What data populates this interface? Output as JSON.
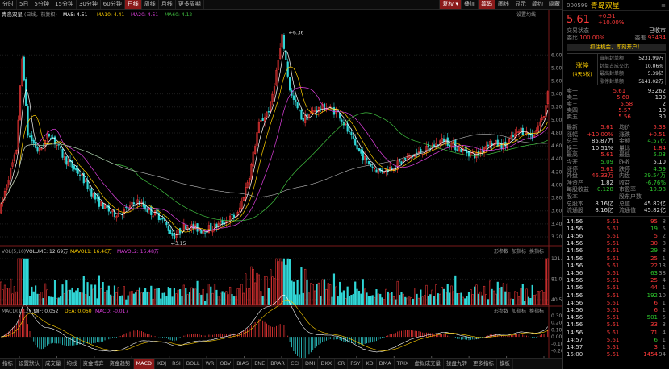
{
  "timeframes": [
    "分时",
    "5日",
    "5分钟",
    "15分钟",
    "30分钟",
    "60分钟",
    "日线",
    "周线",
    "月线",
    "更多周期"
  ],
  "active_timeframe": 6,
  "tools": [
    "叠加",
    "筹码",
    "画线",
    "显示",
    "简约",
    "隐藏"
  ],
  "restore_label": "复权",
  "chart_header": {
    "title": "青岛双星",
    "adj": "(日线，前复权)",
    "ma": [
      {
        "label": "MA5: 4.51",
        "color": "#ffffff"
      },
      {
        "label": "MA10: 4.41",
        "color": "#ffd000"
      },
      {
        "label": "MA20: 4.51",
        "color": "#e040e0"
      },
      {
        "label": "MA60: 4.12",
        "color": "#40c040"
      }
    ],
    "setting": "设置均线"
  },
  "price_axis": [
    "6.00",
    "5.80",
    "5.60",
    "5.40",
    "5.20",
    "5.00",
    "4.80",
    "4.60",
    "4.40",
    "4.20",
    "4.00",
    "3.80",
    "3.60",
    "3.40",
    "3.20"
  ],
  "annotations": {
    "high": "6.36",
    "low": "3.15"
  },
  "volume_header": {
    "label": "VOL(5,10)",
    "vol": "VOLUME: 12.69万",
    "mavol1": "MAVOL1: 16.46万",
    "mavol2": "MAVOL2: 16.48万",
    "links": [
      "形参数",
      "加指标",
      "换指标"
    ]
  },
  "volume_axis": [
    "121.50",
    "81.00",
    "40.50"
  ],
  "macd_header": {
    "label": "MACD(12,26,9)",
    "dif": "DIF: 0.052",
    "dea": "DEA: 0.060",
    "macd": "MACD: -0.017",
    "links": [
      "形参数",
      "加指标",
      "换指标"
    ]
  },
  "macd_axis": [
    "0.30",
    "0.20",
    "0.10",
    "0.00",
    "-0.10",
    "-0.20"
  ],
  "date_axis": [
    "04",
    "05",
    "06",
    "07",
    "08",
    "09",
    "10",
    "11",
    "12",
    "2025",
    "02",
    "03",
    "04",
    "05",
    "06"
  ],
  "bottom_tabs": [
    "指标",
    "设置默认",
    "成交量",
    "均线",
    "资金博弈",
    "资金趋势",
    "MACD",
    "KDJ",
    "RSI",
    "BOLL",
    "WR",
    "OBV",
    "BIAS",
    "ENE",
    "BRAR",
    "CCI",
    "DMI",
    "DKX",
    "CR",
    "PSY",
    "KD",
    "DMA",
    "TRIX",
    "虚拟成交量",
    "操盘九转",
    "更多指标",
    "模板"
  ],
  "active_bottom_tab": 6,
  "stock": {
    "code": "000599",
    "name": "青岛双星",
    "price": "5.61",
    "change": "+0.51",
    "pct": "+10.00%"
  },
  "status": {
    "trade_status_label": "交易状态",
    "trade_status": "已收市",
    "ratio_label": "委比",
    "ratio": "100.00%",
    "diff_label": "委差",
    "diff": "93434"
  },
  "banner": "抓住机会，即刻开户！",
  "limit_box": {
    "title": "涨停",
    "sub": "(4天3板)",
    "rows": [
      {
        "k": "当前封单额",
        "v": "5231.99万"
      },
      {
        "k": "封单占成交比",
        "v": "10.06%"
      },
      {
        "k": "最高封单额",
        "v": "5.39亿"
      },
      {
        "k": "涨停封单额",
        "v": "5141.02万"
      }
    ]
  },
  "asks": [
    {
      "k": "卖一",
      "p": "5.61",
      "v": "93262"
    },
    {
      "k": "卖二",
      "p": "5.60",
      "v": "130"
    },
    {
      "k": "卖三",
      "p": "5.58",
      "v": "2"
    },
    {
      "k": "卖四",
      "p": "5.57",
      "v": "10"
    },
    {
      "k": "卖五",
      "p": "5.56",
      "v": "30"
    }
  ],
  "quote": [
    [
      "最新",
      "5.61",
      "均价",
      "5.33"
    ],
    [
      "涨幅",
      "+10.00%",
      "涨跌",
      "+0.51"
    ],
    [
      "总手",
      "85.87万",
      "金额",
      "4.57亿"
    ],
    [
      "换手",
      "10.51%",
      "量比",
      "1.84"
    ],
    [
      "最高",
      "5.61",
      "最低",
      "5.03"
    ],
    [
      "今开",
      "5.09",
      "昨收",
      "5.10"
    ],
    [
      "涨停",
      "5.61",
      "跌停",
      "4.59"
    ],
    [
      "外盘",
      "46.33万",
      "内盘",
      "39.54万"
    ],
    [
      "净资产",
      "1.82",
      "收益",
      "-6.76%"
    ],
    [
      "每股收益",
      "-0.128",
      "市盈率",
      "-10.98"
    ],
    [
      "股本",
      "",
      "股东户数",
      ""
    ],
    [
      "总股本",
      "8.16亿",
      "总值",
      "45.82亿"
    ],
    [
      "流通股",
      "8.16亿",
      "流通值",
      "45.82亿"
    ]
  ],
  "trades": [
    [
      "14:56",
      "5.61",
      "95",
      "8"
    ],
    [
      "14:56",
      "5.61",
      "19",
      "5"
    ],
    [
      "14:56",
      "5.61",
      "5",
      "2"
    ],
    [
      "14:56",
      "5.61",
      "30",
      "8"
    ],
    [
      "14:56",
      "5.61",
      "29",
      "8"
    ],
    [
      "14:56",
      "5.61",
      "25",
      "1"
    ],
    [
      "14:56",
      "5.61",
      "22",
      "13"
    ],
    [
      "14:56",
      "5.61",
      "63",
      "38"
    ],
    [
      "14:56",
      "5.61",
      "25",
      "4"
    ],
    [
      "14:56",
      "5.61",
      "44",
      "1"
    ],
    [
      "14:56",
      "5.61",
      "192",
      "10"
    ],
    [
      "14:56",
      "5.61",
      "6",
      "1"
    ],
    [
      "14:56",
      "5.61",
      "6",
      "1"
    ],
    [
      "14:56",
      "5.61",
      "501",
      "5"
    ],
    [
      "14:56",
      "5.61",
      "33",
      "3"
    ],
    [
      "14:56",
      "5.61",
      "71",
      "4"
    ],
    [
      "14:57",
      "5.61",
      "6",
      "1"
    ],
    [
      "14:57",
      "5.61",
      "3",
      "1"
    ],
    [
      "15:00",
      "5.61",
      "1454",
      "94"
    ]
  ]
}
